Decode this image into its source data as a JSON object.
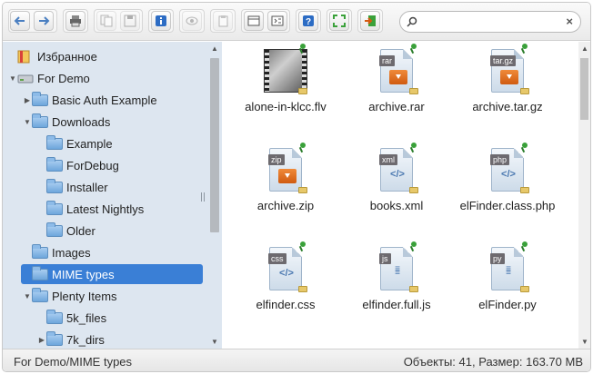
{
  "toolbar": {
    "buttons": [
      {
        "name": "back-button",
        "icon": "arrow-left-icon",
        "disabled": false
      },
      {
        "name": "forward-button",
        "icon": "arrow-right-icon",
        "disabled": false
      },
      {
        "name": "reload-button",
        "icon": "printer-icon",
        "disabled": false
      },
      {
        "name": "open-button",
        "icon": "copy-icon",
        "disabled": true
      },
      {
        "name": "save-button",
        "icon": "save-icon",
        "disabled": true
      },
      {
        "name": "info-button",
        "icon": "info-icon",
        "disabled": false
      },
      {
        "name": "preview-button",
        "icon": "eye-icon",
        "disabled": true
      },
      {
        "name": "copy-button",
        "icon": "paste-icon",
        "disabled": true
      },
      {
        "name": "view-button",
        "icon": "list-view-icon",
        "disabled": false
      },
      {
        "name": "sort-button",
        "icon": "sort-icon",
        "disabled": false
      },
      {
        "name": "help-button",
        "icon": "help-icon",
        "disabled": false
      },
      {
        "name": "fullscreen-button",
        "icon": "fullscreen-icon",
        "disabled": false
      },
      {
        "name": "exit-button",
        "icon": "exit-icon",
        "disabled": false
      }
    ],
    "search_value": "",
    "search_placeholder": ""
  },
  "tree": {
    "items": [
      {
        "label": "Избранное",
        "arrow": "",
        "icon": "favorites-icon",
        "depth": 0
      },
      {
        "label": "For Demo",
        "arrow": "▼",
        "icon": "drive-icon",
        "depth": 0
      },
      {
        "label": "Basic Auth Example",
        "arrow": "▶",
        "icon": "folder-icon",
        "depth": 1
      },
      {
        "label": "Downloads",
        "arrow": "▼",
        "icon": "folder-icon",
        "depth": 1
      },
      {
        "label": "Example",
        "arrow": "",
        "icon": "folder-icon",
        "depth": 2
      },
      {
        "label": "ForDebug",
        "arrow": "",
        "icon": "folder-icon",
        "depth": 2
      },
      {
        "label": "Installer",
        "arrow": "",
        "icon": "folder-icon",
        "depth": 2
      },
      {
        "label": "Latest Nightlys",
        "arrow": "",
        "icon": "folder-icon",
        "depth": 2
      },
      {
        "label": "Older",
        "arrow": "",
        "icon": "folder-icon",
        "depth": 2
      },
      {
        "label": "Images",
        "arrow": "",
        "icon": "folder-icon",
        "depth": 1
      },
      {
        "label": "MIME types",
        "arrow": "",
        "icon": "folder-icon",
        "depth": 1,
        "selected": true
      },
      {
        "label": "Plenty Items",
        "arrow": "▼",
        "icon": "folder-icon",
        "depth": 1
      },
      {
        "label": "5k_files",
        "arrow": "",
        "icon": "folder-icon",
        "depth": 2
      },
      {
        "label": "7k_dirs",
        "arrow": "▶",
        "icon": "folder-icon",
        "depth": 2
      }
    ]
  },
  "files": [
    {
      "name": "alone-in-klcc.flv",
      "kind": "video",
      "tag": ""
    },
    {
      "name": "archive.rar",
      "kind": "archive",
      "tag": "rar"
    },
    {
      "name": "archive.tar.gz",
      "kind": "archive",
      "tag": "tar.gz"
    },
    {
      "name": "archive.zip",
      "kind": "archive",
      "tag": "zip"
    },
    {
      "name": "books.xml",
      "kind": "code",
      "tag": "xml"
    },
    {
      "name": "elFinder.class.php",
      "kind": "code",
      "tag": "php"
    },
    {
      "name": "elfinder.css",
      "kind": "code",
      "tag": "css"
    },
    {
      "name": "elfinder.full.js",
      "kind": "text",
      "tag": "js"
    },
    {
      "name": "elFinder.py",
      "kind": "text",
      "tag": "py"
    }
  ],
  "status": {
    "path": "For Demo/MIME types",
    "stats": "Объекты: 41, Размер: 163.70 MB"
  },
  "colors": {
    "selection": "#3a7fd6",
    "tree_bg": "#dde6f0"
  }
}
